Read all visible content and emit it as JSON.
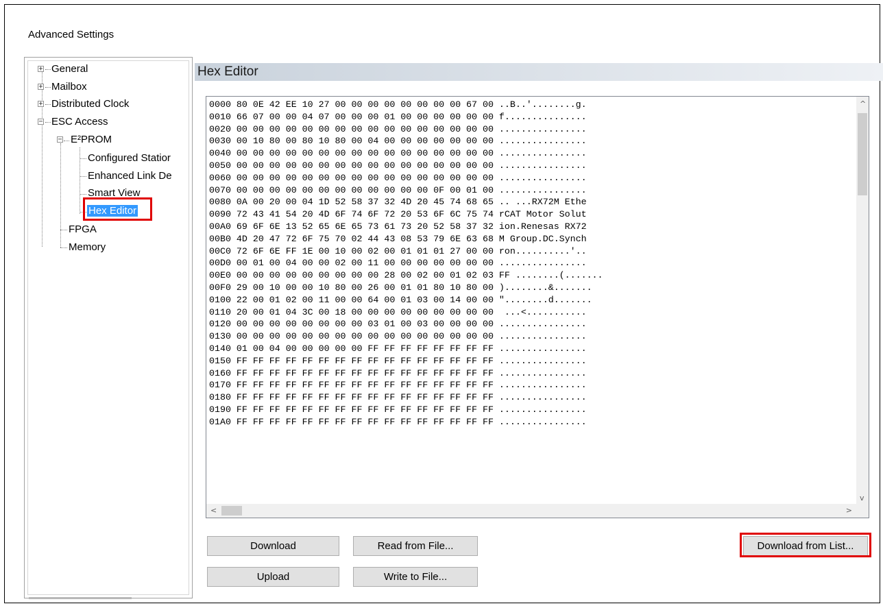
{
  "window": {
    "title": "Advanced Settings"
  },
  "tree": {
    "items": [
      {
        "label": "General",
        "expander": "+"
      },
      {
        "label": "Mailbox",
        "expander": "+"
      },
      {
        "label": "Distributed Clock",
        "expander": "+"
      },
      {
        "label": "ESC Access",
        "expander": "−"
      },
      {
        "label": "E²PROM",
        "expander": "−"
      },
      {
        "label": "Configured Statior"
      },
      {
        "label": "Enhanced Link De"
      },
      {
        "label": "Smart View"
      },
      {
        "label": "Hex Editor"
      },
      {
        "label": "FPGA"
      },
      {
        "label": "Memory"
      }
    ]
  },
  "panel": {
    "title": "Hex Editor"
  },
  "hex": {
    "lines": [
      "0000 80 0E 42 EE 10 27 00 00 00 00 00 00 00 00 67 00 ..B..'........g.",
      "0010 66 07 00 00 04 07 00 00 00 01 00 00 00 00 00 00 f...............",
      "0020 00 00 00 00 00 00 00 00 00 00 00 00 00 00 00 00 ................",
      "0030 00 10 80 00 80 10 80 00 04 00 00 00 00 00 00 00 ................",
      "0040 00 00 00 00 00 00 00 00 00 00 00 00 00 00 00 00 ................",
      "0050 00 00 00 00 00 00 00 00 00 00 00 00 00 00 00 00 ................",
      "0060 00 00 00 00 00 00 00 00 00 00 00 00 00 00 00 00 ................",
      "0070 00 00 00 00 00 00 00 00 00 00 00 00 0F 00 01 00 ................",
      "0080 0A 00 20 00 04 1D 52 58 37 32 4D 20 45 74 68 65 .. ...RX72M Ethe",
      "0090 72 43 41 54 20 4D 6F 74 6F 72 20 53 6F 6C 75 74 rCAT Motor Solut",
      "00A0 69 6F 6E 13 52 65 6E 65 73 61 73 20 52 58 37 32 ion.Renesas RX72",
      "00B0 4D 20 47 72 6F 75 70 02 44 43 08 53 79 6E 63 68 M Group.DC.Synch",
      "00C0 72 6F 6E FF 1E 00 10 00 02 00 01 01 01 27 00 00 ron..........'..",
      "00D0 00 01 00 04 00 00 02 00 11 00 00 00 00 00 00 00 ................",
      "00E0 00 00 00 00 00 00 00 00 00 28 00 02 00 01 02 03 FF ........(.......",
      "00F0 29 00 10 00 00 10 80 00 26 00 01 01 80 10 80 00 )........&.......",
      "0100 22 00 01 02 00 11 00 00 64 00 01 03 00 14 00 00 \"........d.......",
      "0110 20 00 01 04 3C 00 18 00 00 00 00 00 00 00 00 00  ...<...........",
      "0120 00 00 00 00 00 00 00 00 03 01 00 03 00 00 00 00 ................",
      "0130 00 00 00 00 00 00 00 00 00 00 00 00 00 00 00 00 ................",
      "0140 01 00 04 00 00 00 00 00 FF FF FF FF FF FF FF FF ................",
      "0150 FF FF FF FF FF FF FF FF FF FF FF FF FF FF FF FF ................",
      "0160 FF FF FF FF FF FF FF FF FF FF FF FF FF FF FF FF ................",
      "0170 FF FF FF FF FF FF FF FF FF FF FF FF FF FF FF FF ................",
      "0180 FF FF FF FF FF FF FF FF FF FF FF FF FF FF FF FF ................",
      "0190 FF FF FF FF FF FF FF FF FF FF FF FF FF FF FF FF ................",
      "01A0 FF FF FF FF FF FF FF FF FF FF FF FF FF FF FF FF ................"
    ]
  },
  "scroll": {
    "up": "^",
    "down": "v",
    "left": "<",
    "right": ">"
  },
  "buttons": {
    "download": "Download",
    "read_from_file": "Read from File...",
    "download_from_list": "Download from List...",
    "upload": "Upload",
    "write_to_file": "Write to File..."
  },
  "colors": {
    "highlight": "#e00000",
    "selection": "#3399ff"
  }
}
